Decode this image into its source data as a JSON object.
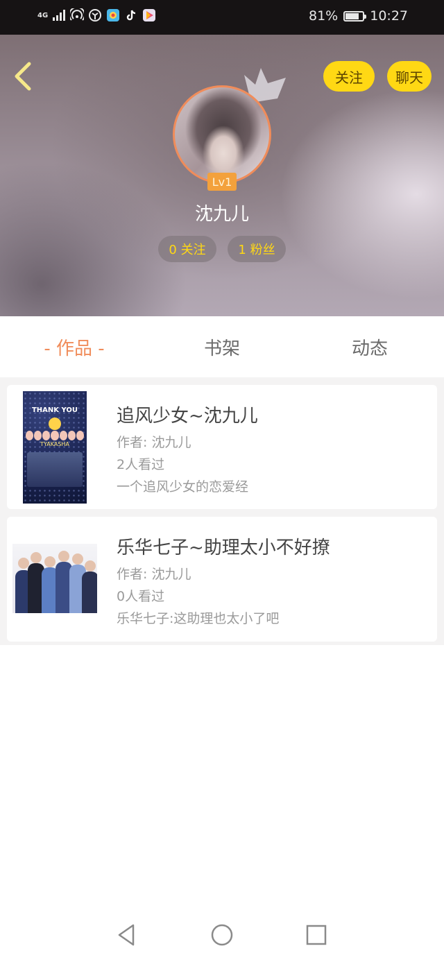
{
  "status_bar": {
    "network": "4G",
    "battery": "81%",
    "battery_level": 0.81,
    "time": "10:27",
    "icons": [
      "signal-icon",
      "hotspot-icon",
      "vpn-icon",
      "app-icon",
      "tiktok-icon",
      "video-app-icon"
    ]
  },
  "header": {
    "follow_label": "关注",
    "chat_label": "聊天",
    "level": "Lv1",
    "username": "沈九儿",
    "following": "0 关注",
    "fans": "1 粉丝",
    "accent": "#ffd814"
  },
  "tabs": [
    {
      "label": "- 作品 -",
      "active": true
    },
    {
      "label": "书架",
      "active": false
    },
    {
      "label": "动态",
      "active": false
    }
  ],
  "works": [
    {
      "title": "追风少女~沈九儿",
      "author": "作者: 沈九儿",
      "views": "2人看过",
      "summary": "一个追风少女的恋爱经",
      "cover_text": "THANK YOU",
      "cover_subtext": "TYAKASHA"
    },
    {
      "title": "乐华七子~助理太小不好撩",
      "author": "作者: 沈九儿",
      "views": "0人看过",
      "summary": "乐华七子:这助理也太小了吧"
    }
  ],
  "nav": [
    "back-triangle-icon",
    "home-circle-icon",
    "recents-square-icon"
  ],
  "colors": {
    "tab_active": "#f08c5a",
    "avatar_ring": "#f08c5a",
    "level_badge": "#f3a13c"
  }
}
